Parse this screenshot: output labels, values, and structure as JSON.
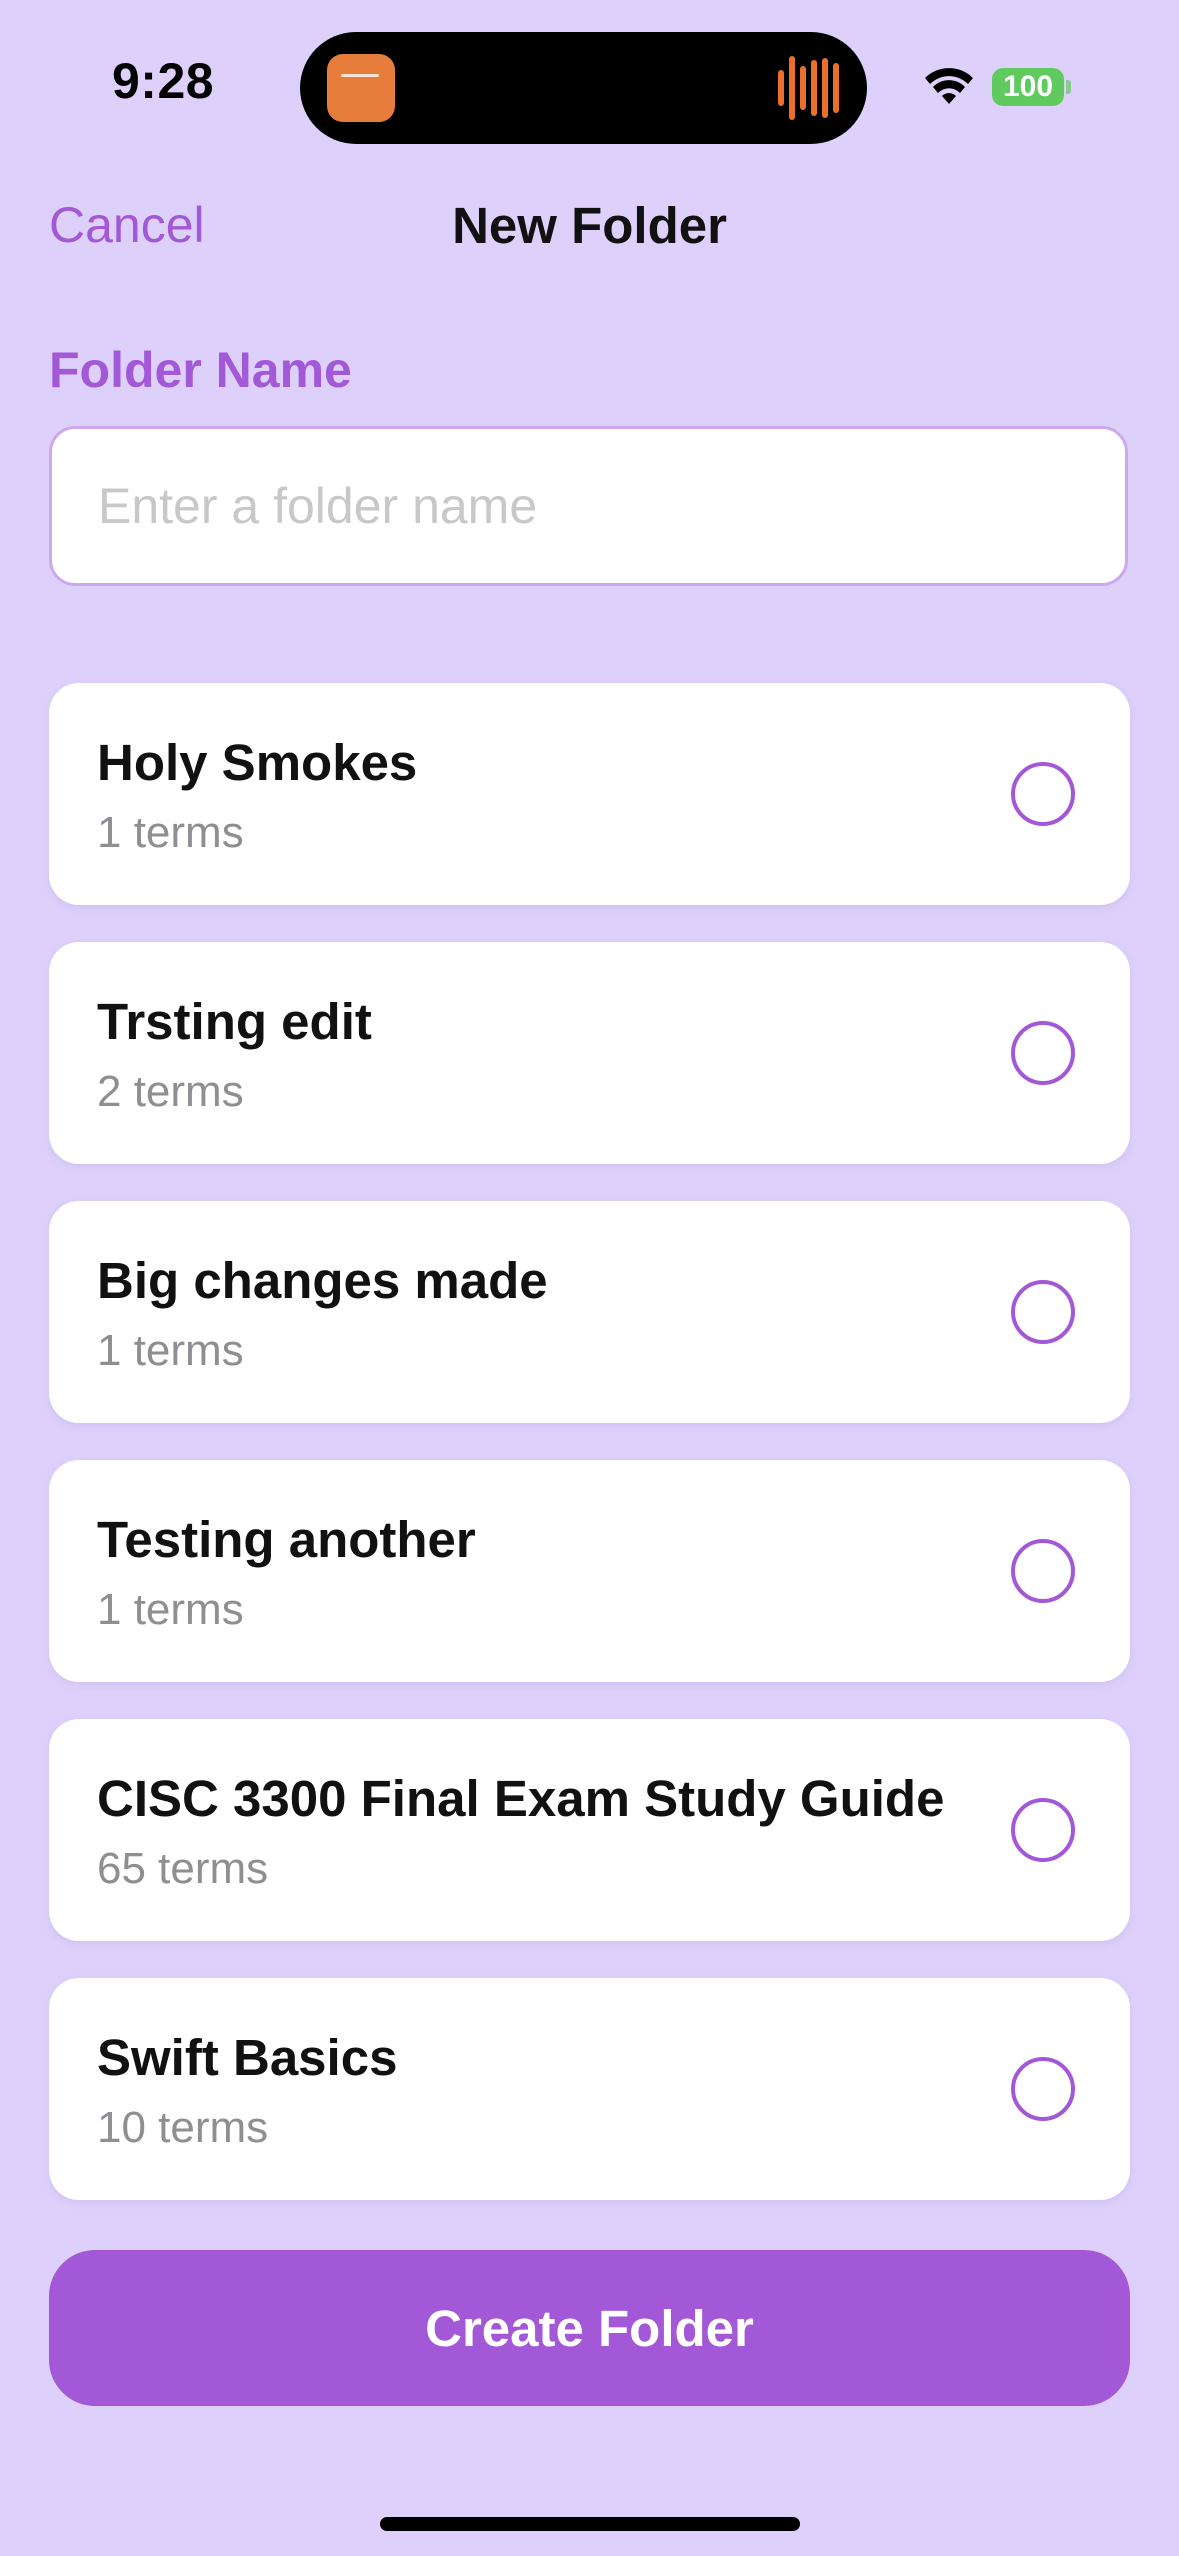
{
  "status_bar": {
    "time": "9:28",
    "battery": "100"
  },
  "nav": {
    "cancel_label": "Cancel",
    "title": "New Folder"
  },
  "folder_name": {
    "label": "Folder Name",
    "placeholder": "Enter a folder name",
    "value": ""
  },
  "sets": [
    {
      "title": "Holy Smokes",
      "subtitle": "1 terms"
    },
    {
      "title": "Trsting edit",
      "subtitle": "2 terms"
    },
    {
      "title": "Big changes made",
      "subtitle": "1 terms"
    },
    {
      "title": "Testing another",
      "subtitle": "1 terms"
    },
    {
      "title": "CISC 3300 Final Exam Study Guide",
      "subtitle": "65 terms"
    },
    {
      "title": "Swift Basics",
      "subtitle": "10 terms"
    }
  ],
  "create_button_label": "Create Folder",
  "colors": {
    "background": "#ddd1fb",
    "accent": "#a258d7",
    "battery": "#5fcb5e",
    "island_app": "#e77d3a"
  },
  "icons": {
    "wifi": "wifi-icon",
    "radio": "radio-unselected-icon"
  }
}
